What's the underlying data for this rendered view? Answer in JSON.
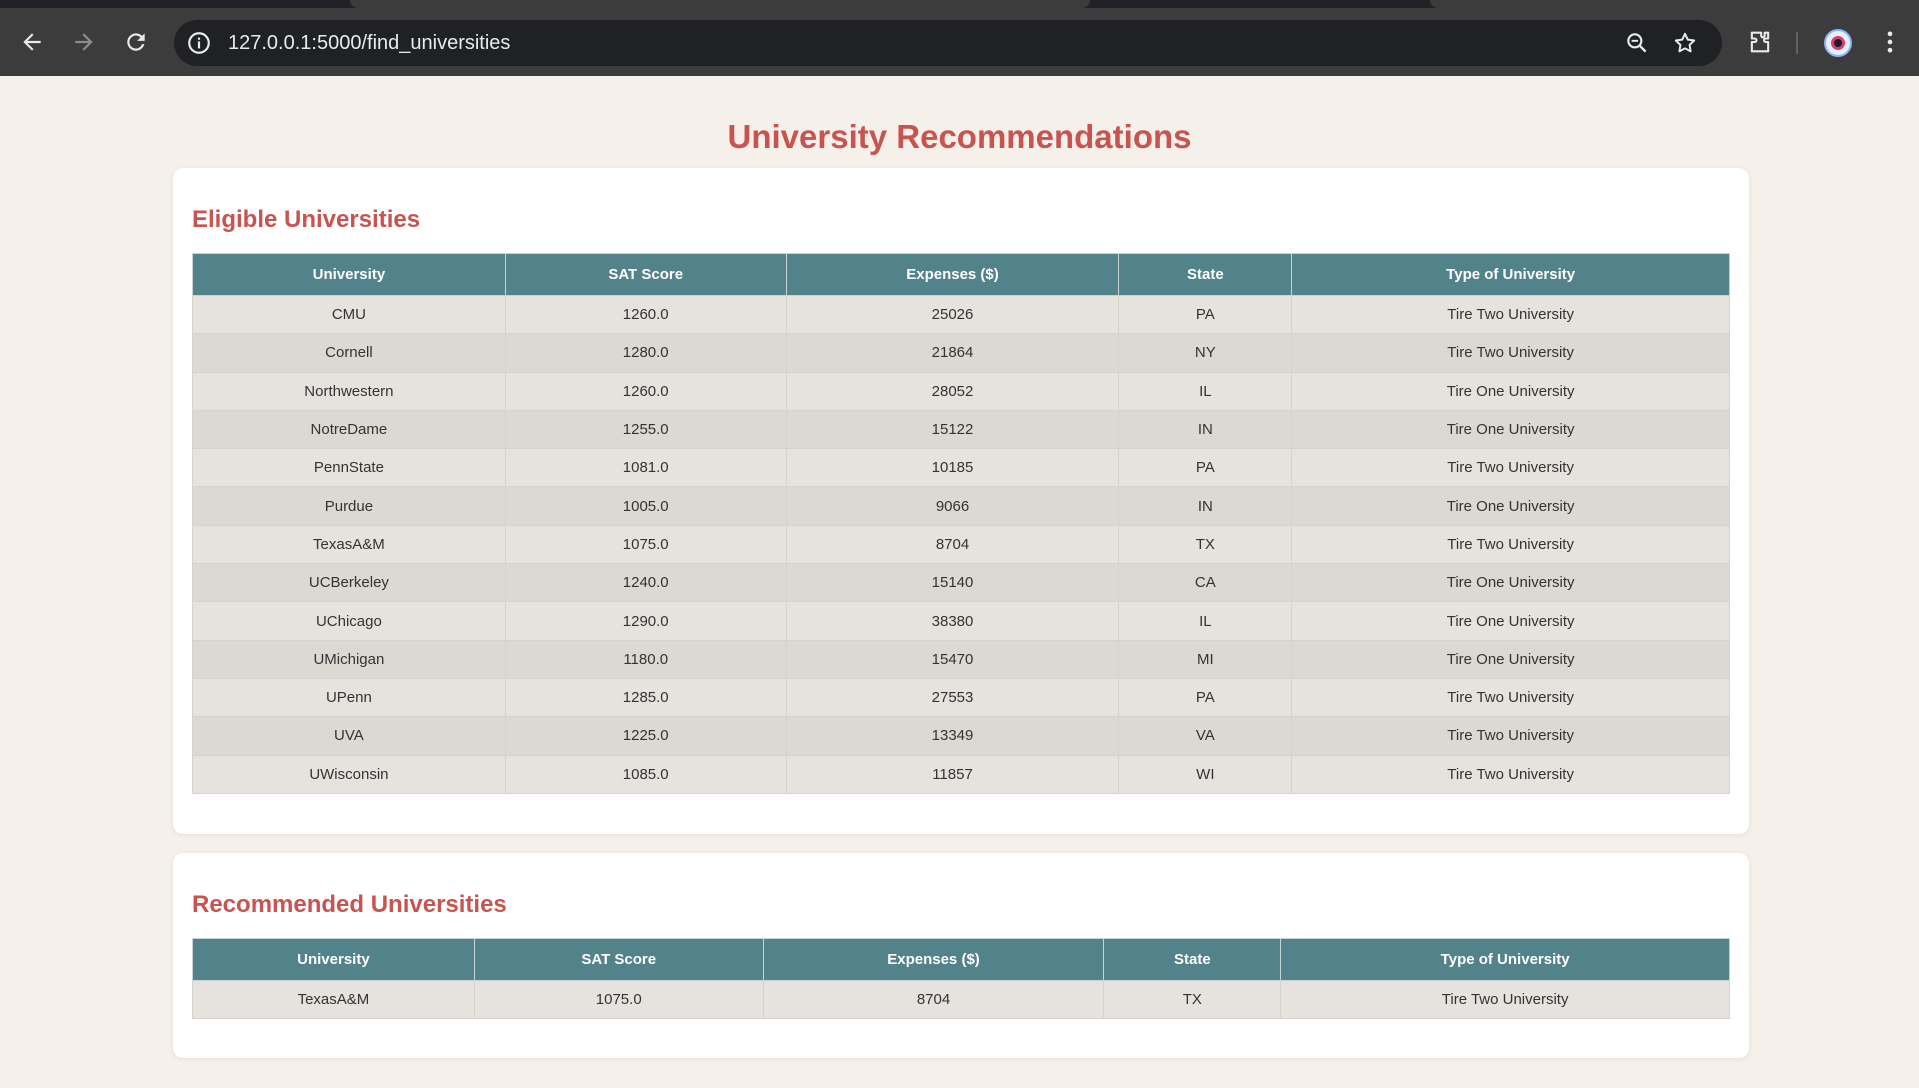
{
  "browser": {
    "url": "127.0.0.1:5000/find_universities"
  },
  "page": {
    "title": "University Recommendations"
  },
  "eligible": {
    "heading": "Eligible Universities",
    "columns": [
      "University",
      "SAT Score",
      "Expenses ($)",
      "State",
      "Type of University"
    ],
    "rows": [
      [
        "CMU",
        "1260.0",
        "25026",
        "PA",
        "Tire Two University"
      ],
      [
        "Cornell",
        "1280.0",
        "21864",
        "NY",
        "Tire Two University"
      ],
      [
        "Northwestern",
        "1260.0",
        "28052",
        "IL",
        "Tire One University"
      ],
      [
        "NotreDame",
        "1255.0",
        "15122",
        "IN",
        "Tire One University"
      ],
      [
        "PennState",
        "1081.0",
        "10185",
        "PA",
        "Tire Two University"
      ],
      [
        "Purdue",
        "1005.0",
        "9066",
        "IN",
        "Tire One University"
      ],
      [
        "TexasA&M",
        "1075.0",
        "8704",
        "TX",
        "Tire Two University"
      ],
      [
        "UCBerkeley",
        "1240.0",
        "15140",
        "CA",
        "Tire One University"
      ],
      [
        "UChicago",
        "1290.0",
        "38380",
        "IL",
        "Tire One University"
      ],
      [
        "UMichigan",
        "1180.0",
        "15470",
        "MI",
        "Tire One University"
      ],
      [
        "UPenn",
        "1285.0",
        "27553",
        "PA",
        "Tire Two University"
      ],
      [
        "UVA",
        "1225.0",
        "13349",
        "VA",
        "Tire Two University"
      ],
      [
        "UWisconsin",
        "1085.0",
        "11857",
        "WI",
        "Tire Two University"
      ]
    ]
  },
  "recommended": {
    "heading": "Recommended Universities",
    "columns": [
      "University",
      "SAT Score",
      "Expenses ($)",
      "State",
      "Type of University"
    ],
    "rows": [
      [
        "TexasA&M",
        "1075.0",
        "8704",
        "TX",
        "Tire Two University"
      ]
    ]
  }
}
